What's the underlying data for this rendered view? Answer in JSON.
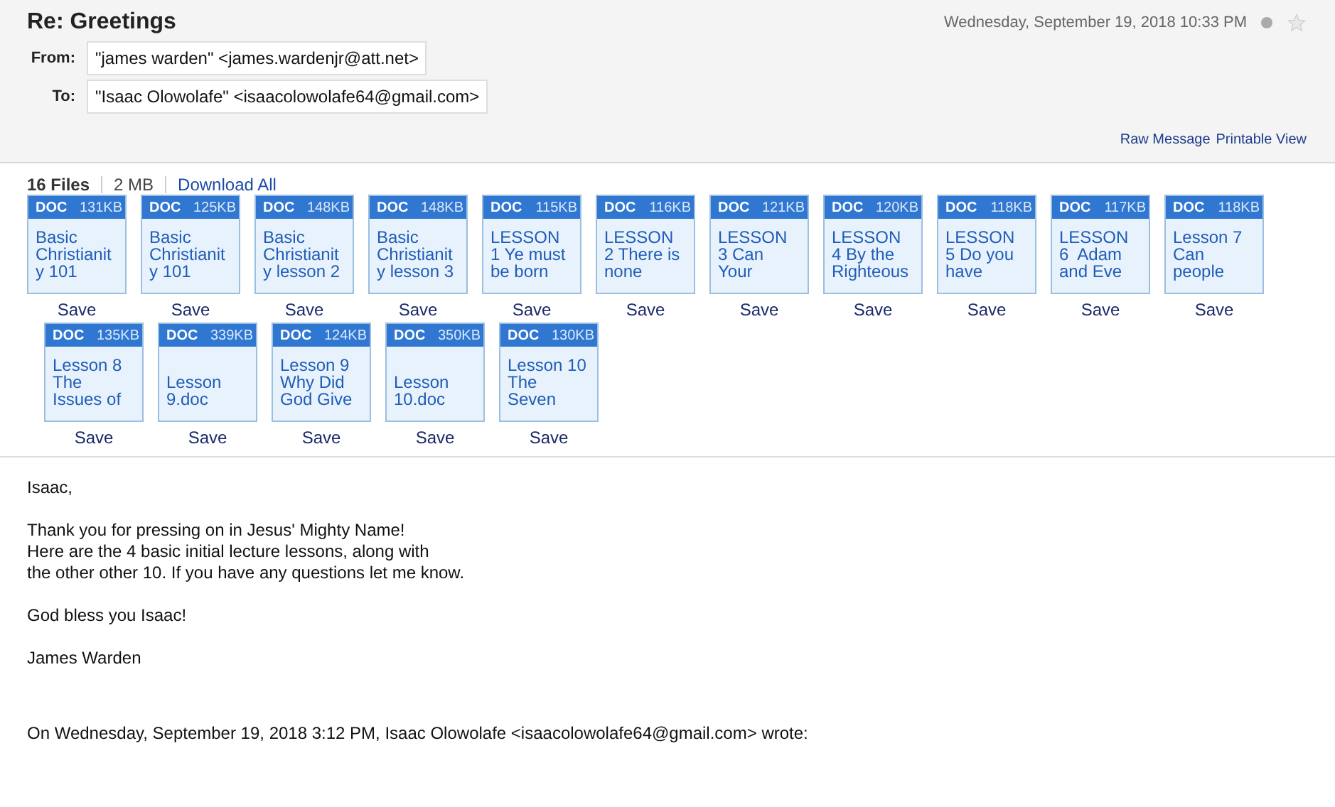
{
  "subject": "Re: Greetings",
  "date": "Wednesday, September 19, 2018 10:33 PM",
  "starred": false,
  "from": {
    "label": "From:",
    "value": "\"james warden\" <james.wardenjr@att.net>"
  },
  "to": {
    "label": "To:",
    "value": "\"Isaac Olowolafe\" <isaacolowolafe64@gmail.com>"
  },
  "links": [
    "Raw Message",
    "Printable View"
  ],
  "attachments_bar": {
    "count": "16 Files",
    "size": "2 MB",
    "download": "Download All"
  },
  "attachment_rows": [
    [
      {
        "type": "DOC",
        "size": "131KB",
        "lines": [
          "Basic",
          "Christianit",
          "y 101"
        ],
        "save": "Save"
      },
      {
        "type": "DOC",
        "size": "125KB",
        "lines": [
          "Basic",
          "Christianit",
          "y 101"
        ],
        "save": "Save"
      },
      {
        "type": "DOC",
        "size": "148KB",
        "lines": [
          "Basic",
          "Christianit",
          "y lesson 2"
        ],
        "save": "Save"
      },
      {
        "type": "DOC",
        "size": "148KB",
        "lines": [
          "Basic",
          "Christianit",
          "y lesson 3"
        ],
        "save": "Save"
      },
      {
        "type": "DOC",
        "size": "115KB",
        "lines": [
          "LESSON",
          "1 Ye must",
          "be born"
        ],
        "save": "Save"
      },
      {
        "type": "DOC",
        "size": "116KB",
        "lines": [
          "LESSON",
          "2 There is",
          "none"
        ],
        "save": "Save"
      },
      {
        "type": "DOC",
        "size": "121KB",
        "lines": [
          "LESSON",
          "3 Can",
          "Your"
        ],
        "save": "Save"
      },
      {
        "type": "DOC",
        "size": "120KB",
        "lines": [
          "LESSON",
          "4 By the",
          "Righteous"
        ],
        "save": "Save"
      },
      {
        "type": "DOC",
        "size": "118KB",
        "lines": [
          "LESSON",
          "5 Do you",
          "have"
        ],
        "save": "Save"
      },
      {
        "type": "DOC",
        "size": "117KB",
        "lines": [
          "LESSON",
          "6  Adam",
          "and Eve"
        ],
        "save": "Save"
      },
      {
        "type": "DOC",
        "size": "118KB",
        "lines": [
          "Lesson 7",
          "Can",
          "people"
        ],
        "save": "Save"
      }
    ],
    [
      {
        "type": "DOC",
        "size": "135KB",
        "lines": [
          "Lesson 8",
          "The",
          "Issues of"
        ],
        "save": "Save"
      },
      {
        "type": "DOC",
        "size": "339KB",
        "lines": [
          "Lesson",
          "9.doc"
        ],
        "save": "Save"
      },
      {
        "type": "DOC",
        "size": "124KB",
        "lines": [
          "Lesson 9",
          "Why Did",
          "God Give"
        ],
        "save": "Save"
      },
      {
        "type": "DOC",
        "size": "350KB",
        "lines": [
          "Lesson",
          "10.doc"
        ],
        "save": "Save"
      },
      {
        "type": "DOC",
        "size": "130KB",
        "lines": [
          "Lesson 10",
          "The",
          "Seven"
        ],
        "save": "Save"
      }
    ]
  ],
  "body": [
    "Isaac,",
    "Thank you for pressing on in Jesus' Mighty Name!\nHere are the 4 basic initial lecture lessons, along with\nthe other other 10. If you have any questions let me know.",
    "God bless you Isaac!",
    "James Warden"
  ],
  "quote_header": "On Wednesday, September 19, 2018 3:12 PM, Isaac Olowolafe <isaacolowolafe64@gmail.com> wrote:"
}
